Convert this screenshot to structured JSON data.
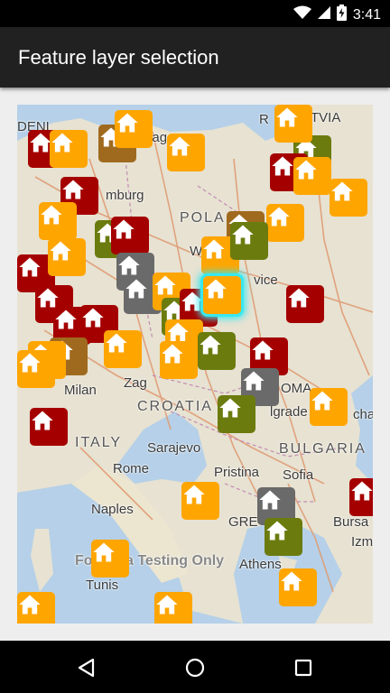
{
  "status_bar": {
    "time": "3:41",
    "icons": [
      "wifi-icon",
      "cell-signal-icon",
      "battery-charging-icon"
    ]
  },
  "app_bar": {
    "title": "Feature layer selection"
  },
  "map": {
    "labels": {
      "denmark": "DENI",
      "latvia": "TVIA",
      "copenhagen": "penhagen",
      "hamburg": "mburg",
      "poland": "POLA",
      "warsaw": "W",
      "vilnius": "vice",
      "milan": "Milan",
      "zagreb": "Zag",
      "croatia": "CROATIA",
      "italy": "ITALY",
      "sarajevo": "Sarajevo",
      "belgrade": "lgrade",
      "romania": "OMA",
      "bulgaria": "BULGARIA",
      "rome": "Rome",
      "pristina": "Pristina",
      "sofia": "Sofia",
      "naples": "Naples",
      "greece": "GRE",
      "athens": "Athens",
      "tunis": "Tunis",
      "izmir": "Izm",
      "bursa": "Bursa",
      "cha": "cha",
      "r": "R"
    },
    "watermark": "For Beta Testing Only",
    "colors": {
      "orange": "#ffa500",
      "red": "#a50000",
      "olive": "#6b7b0e",
      "brown": "#a06a1e",
      "gray": "#6a6a6a",
      "selection": "#38e8f0"
    }
  },
  "navigation": {
    "back": "back-icon",
    "home": "home-icon",
    "recents": "recents-icon"
  }
}
